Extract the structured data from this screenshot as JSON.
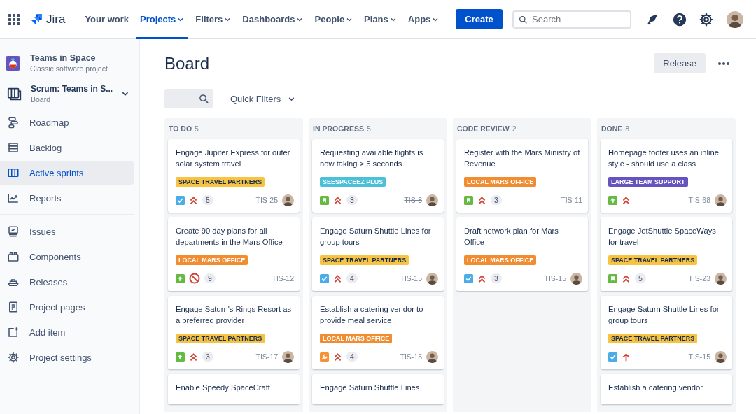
{
  "topnav": {
    "product": "Jira",
    "items": [
      {
        "label": "Your work",
        "dropdown": false,
        "selected": false
      },
      {
        "label": "Projects",
        "dropdown": true,
        "selected": true
      },
      {
        "label": "Filters",
        "dropdown": true,
        "selected": false
      },
      {
        "label": "Dashboards",
        "dropdown": true,
        "selected": false
      },
      {
        "label": "People",
        "dropdown": true,
        "selected": false
      },
      {
        "label": "Plans",
        "dropdown": true,
        "selected": false
      },
      {
        "label": "Apps",
        "dropdown": true,
        "selected": false
      }
    ],
    "create": "Create",
    "search": {
      "placeholder": "Search"
    }
  },
  "sidebar": {
    "project": {
      "name": "Teams in Space",
      "type": "Classic software project"
    },
    "board": {
      "name": "Scrum: Teams in S...",
      "subtitle": "Board"
    },
    "sections": [
      {
        "items": [
          {
            "label": "Roadmap",
            "kind": "roadmap",
            "selected": false
          },
          {
            "label": "Backlog",
            "kind": "backlog",
            "selected": false
          },
          {
            "label": "Active sprints",
            "kind": "board",
            "selected": true
          },
          {
            "label": "Reports",
            "kind": "chart",
            "selected": false
          }
        ]
      },
      {
        "items": [
          {
            "label": "Issues",
            "kind": "issues",
            "selected": false
          },
          {
            "label": "Components",
            "kind": "components",
            "selected": false
          },
          {
            "label": "Releases",
            "kind": "releases",
            "selected": false
          },
          {
            "label": "Project pages",
            "kind": "page",
            "selected": false
          },
          {
            "label": "Add item",
            "kind": "add",
            "selected": false
          },
          {
            "label": "Project settings",
            "kind": "settings",
            "selected": false
          }
        ]
      }
    ]
  },
  "board": {
    "title": "Board",
    "release": "Release",
    "quick_filters": "Quick Filters",
    "columns": [
      {
        "name": "TO DO",
        "count": "5",
        "cards": [
          {
            "title": "Engage Jupiter Express for outer solar system travel",
            "label": {
              "text": "SPACE TRAVEL PARTNERS",
              "color": "#f6c342"
            },
            "type": {
              "kind": "task"
            },
            "priority": {
              "kind": "highest"
            },
            "points": "5",
            "key": "TIS-25",
            "resolved": false,
            "avatar": true
          },
          {
            "title": "Create 90 day plans for all departments in the Mars Office",
            "label": {
              "text": "LOCAL MARS OFFICE",
              "color": "#f18d30"
            },
            "type": {
              "kind": "improvement"
            },
            "priority": {
              "kind": "blocker"
            },
            "points": "9",
            "key": "TIS-12",
            "resolved": false,
            "avatar": false
          },
          {
            "title": "Engage Saturn's Rings Resort as a preferred provider",
            "label": {
              "text": "SPACE TRAVEL PARTNERS",
              "color": "#f6c342"
            },
            "type": {
              "kind": "improvement"
            },
            "priority": {
              "kind": "highest"
            },
            "points": "3",
            "key": "TIS-17",
            "resolved": false,
            "avatar": true
          },
          {
            "title": "Enable Speedy SpaceCraft"
          }
        ]
      },
      {
        "name": "IN PROGRESS",
        "count": "5",
        "cards": [
          {
            "title": "Requesting available flights is now taking > 5 seconds",
            "label": {
              "text": "SEESPACEEZ PLUS",
              "color": "#4bc0d9"
            },
            "type": {
              "kind": "story"
            },
            "priority": {
              "kind": "highest"
            },
            "points": "3",
            "key": "TIS-8",
            "resolved": true,
            "avatar": true
          },
          {
            "title": "Engage Saturn Shuttle Lines for group tours",
            "label": {
              "text": "SPACE TRAVEL PARTNERS",
              "color": "#f6c342"
            },
            "type": {
              "kind": "task"
            },
            "priority": {
              "kind": "highest"
            },
            "points": "4",
            "key": "TIS-15",
            "resolved": false,
            "avatar": true
          },
          {
            "title": "Establish a catering vendor to provide meal service",
            "label": {
              "text": "LOCAL MARS OFFICE",
              "color": "#f18d30"
            },
            "type": {
              "kind": "wrench"
            },
            "priority": {
              "kind": "highest"
            },
            "points": "4",
            "key": "TIS-15",
            "resolved": false,
            "avatar": true
          },
          {
            "title": "Engage Saturn Shuttle Lines"
          }
        ]
      },
      {
        "name": "CODE REVIEW",
        "count": "2",
        "cards": [
          {
            "title": "Register with the Mars Ministry of Revenue",
            "label": {
              "text": "LOCAL MARS OFFICE",
              "color": "#f18d30"
            },
            "type": {
              "kind": "story"
            },
            "priority": {
              "kind": "highest"
            },
            "points": "3",
            "key": "TIS-11",
            "resolved": false,
            "avatar": false
          },
          {
            "title": "Draft network plan for Mars Office",
            "label": {
              "text": "LOCAL MARS OFFICE",
              "color": "#f18d30"
            },
            "type": {
              "kind": "task"
            },
            "priority": {
              "kind": "highest"
            },
            "points": "3",
            "key": "TIS-15",
            "resolved": false,
            "avatar": true
          }
        ]
      },
      {
        "name": "DONE",
        "count": "8",
        "cards": [
          {
            "title": "Homepage footer uses an inline style - should use a class",
            "label": {
              "text": "LARGE TEAM SUPPORT",
              "color": "#6554c0"
            },
            "type": {
              "kind": "improvement"
            },
            "priority": {
              "kind": "highest"
            },
            "key": "TIS-68",
            "resolved": false,
            "avatar": true
          },
          {
            "title": "Engage JetShuttle SpaceWays for travel",
            "label": {
              "text": "SPACE TRAVEL PARTNERS",
              "color": "#f6c342"
            },
            "type": {
              "kind": "story"
            },
            "priority": {
              "kind": "highest"
            },
            "points": "5",
            "key": "TIS-23",
            "resolved": false,
            "avatar": true
          },
          {
            "title": "Engage Saturn Shuttle Lines for group tours",
            "label": {
              "text": "SPACE TRAVEL PARTNERS",
              "color": "#f6c342"
            },
            "type": {
              "kind": "task"
            },
            "priority": {
              "kind": "high"
            },
            "key": "TIS-15",
            "resolved": false,
            "avatar": true
          },
          {
            "title": "Establish a catering vendor"
          }
        ]
      }
    ]
  }
}
